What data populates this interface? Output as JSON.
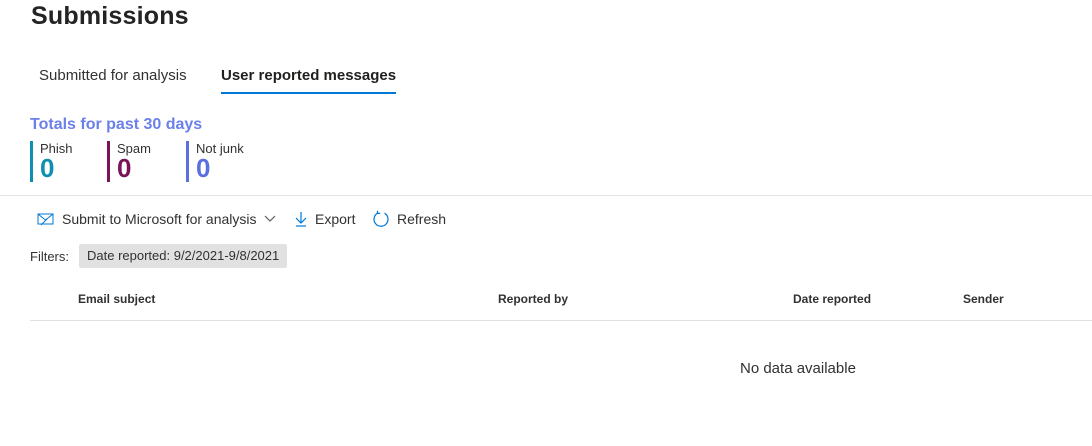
{
  "page": {
    "title": "Submissions"
  },
  "tabs": [
    {
      "label": "Submitted for analysis",
      "selected": false
    },
    {
      "label": "User reported messages",
      "selected": true
    }
  ],
  "totals": {
    "title": "Totals for past 30 days",
    "metrics": [
      {
        "label": "Phish",
        "value": "0",
        "color": "#0f8fb0"
      },
      {
        "label": "Spam",
        "value": "0",
        "color": "#7a1457"
      },
      {
        "label": "Not junk",
        "value": "0",
        "color": "#5a6fe0"
      }
    ]
  },
  "toolbar": {
    "submit_label": "Submit to Microsoft for analysis",
    "export_label": "Export",
    "refresh_label": "Refresh"
  },
  "filters": {
    "label": "Filters:",
    "chip": "Date reported: 9/2/2021-9/8/2021"
  },
  "table": {
    "columns": [
      "Email subject",
      "Reported by",
      "Date reported",
      "Sender"
    ],
    "rows": [],
    "empty_text": "No data available"
  },
  "colors": {
    "accent": "#0078d4",
    "totals_title": "#6b80e8"
  },
  "icons": [
    "submit-mail-icon",
    "chevron-down-icon",
    "download-icon",
    "refresh-icon"
  ]
}
